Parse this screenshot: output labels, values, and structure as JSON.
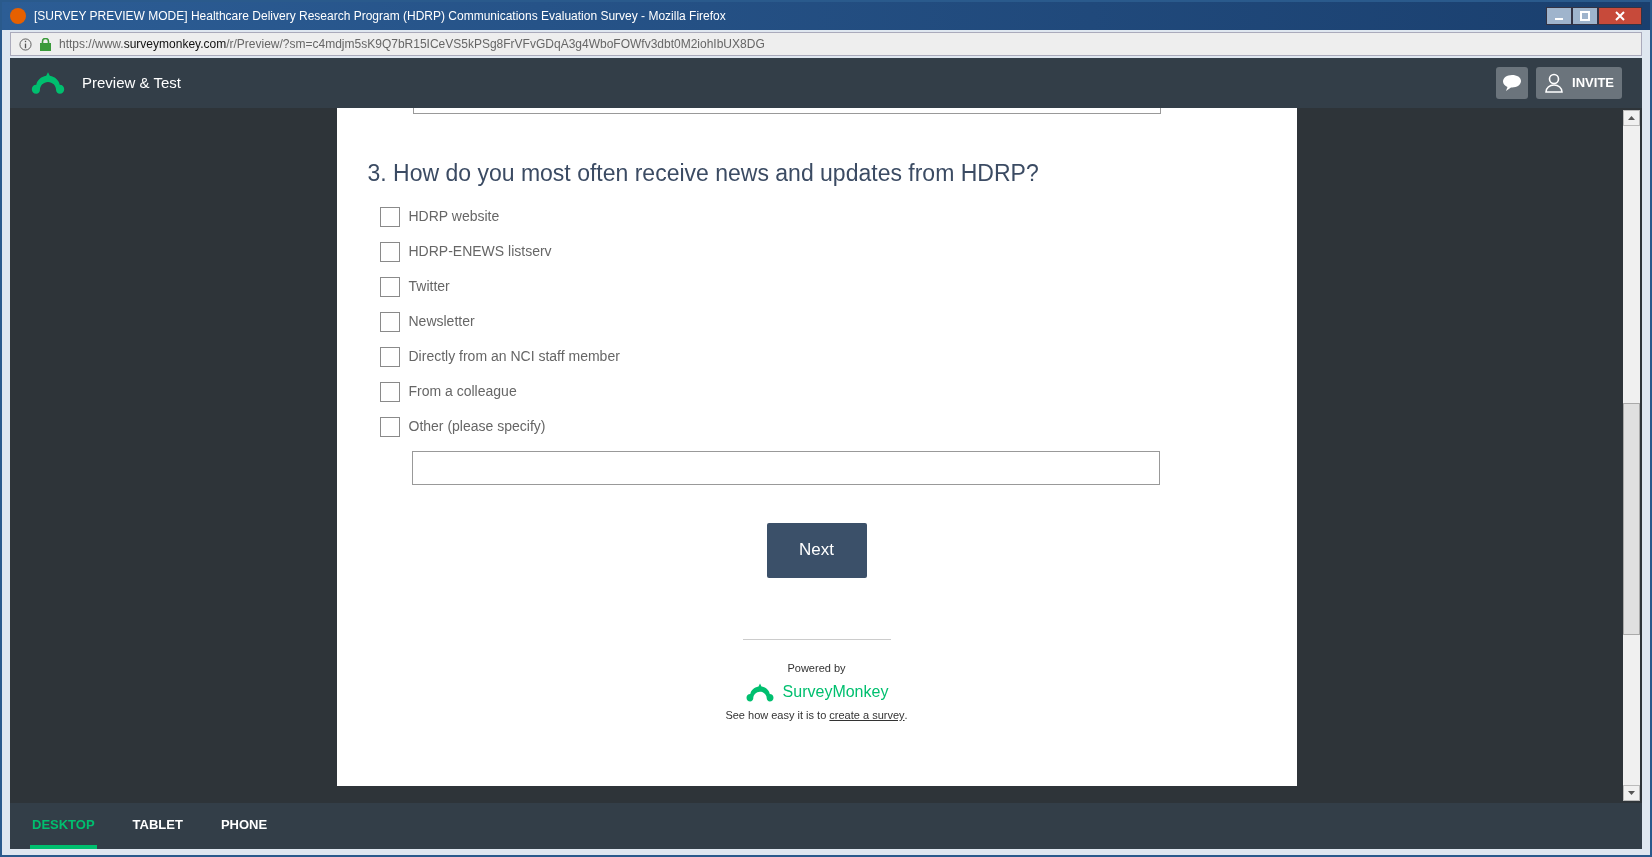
{
  "window": {
    "title": "[SURVEY PREVIEW MODE] Healthcare Delivery Research Program (HDRP) Communications Evaluation Survey - Mozilla Firefox"
  },
  "address_bar": {
    "prefix": "https://www.",
    "domain": "surveymonkey.com",
    "path": "/r/Preview/?sm=c4mdjm5sK9Q7bR15ICeVS5kPSg8FrVFvGDqA3g4WboFOWfv3dbt0M2iohIbUX8DG"
  },
  "header": {
    "title": "Preview & Test",
    "invite_button": "INVITE"
  },
  "question": {
    "title": "3. How do you most often receive news and updates from HDRP?",
    "options": [
      {
        "label": "HDRP website",
        "checked": false
      },
      {
        "label": "HDRP-ENEWS listserv",
        "checked": false
      },
      {
        "label": "Twitter",
        "checked": false
      },
      {
        "label": "Newsletter",
        "checked": false
      },
      {
        "label": "Directly from an NCI staff member",
        "checked": false
      },
      {
        "label": "From a colleague",
        "checked": false
      },
      {
        "label": "Other (please specify)",
        "checked": false
      }
    ]
  },
  "next_button": "Next",
  "footer": {
    "powered_by": "Powered by",
    "brand": "SurveyMonkey",
    "tagline": "See how easy it is to",
    "link": "create a survey",
    "end": "."
  },
  "device_tabs": [
    {
      "label": "DESKTOP",
      "selected": true
    },
    {
      "label": "TABLET",
      "selected": false
    },
    {
      "label": "PHONE",
      "selected": false
    }
  ]
}
